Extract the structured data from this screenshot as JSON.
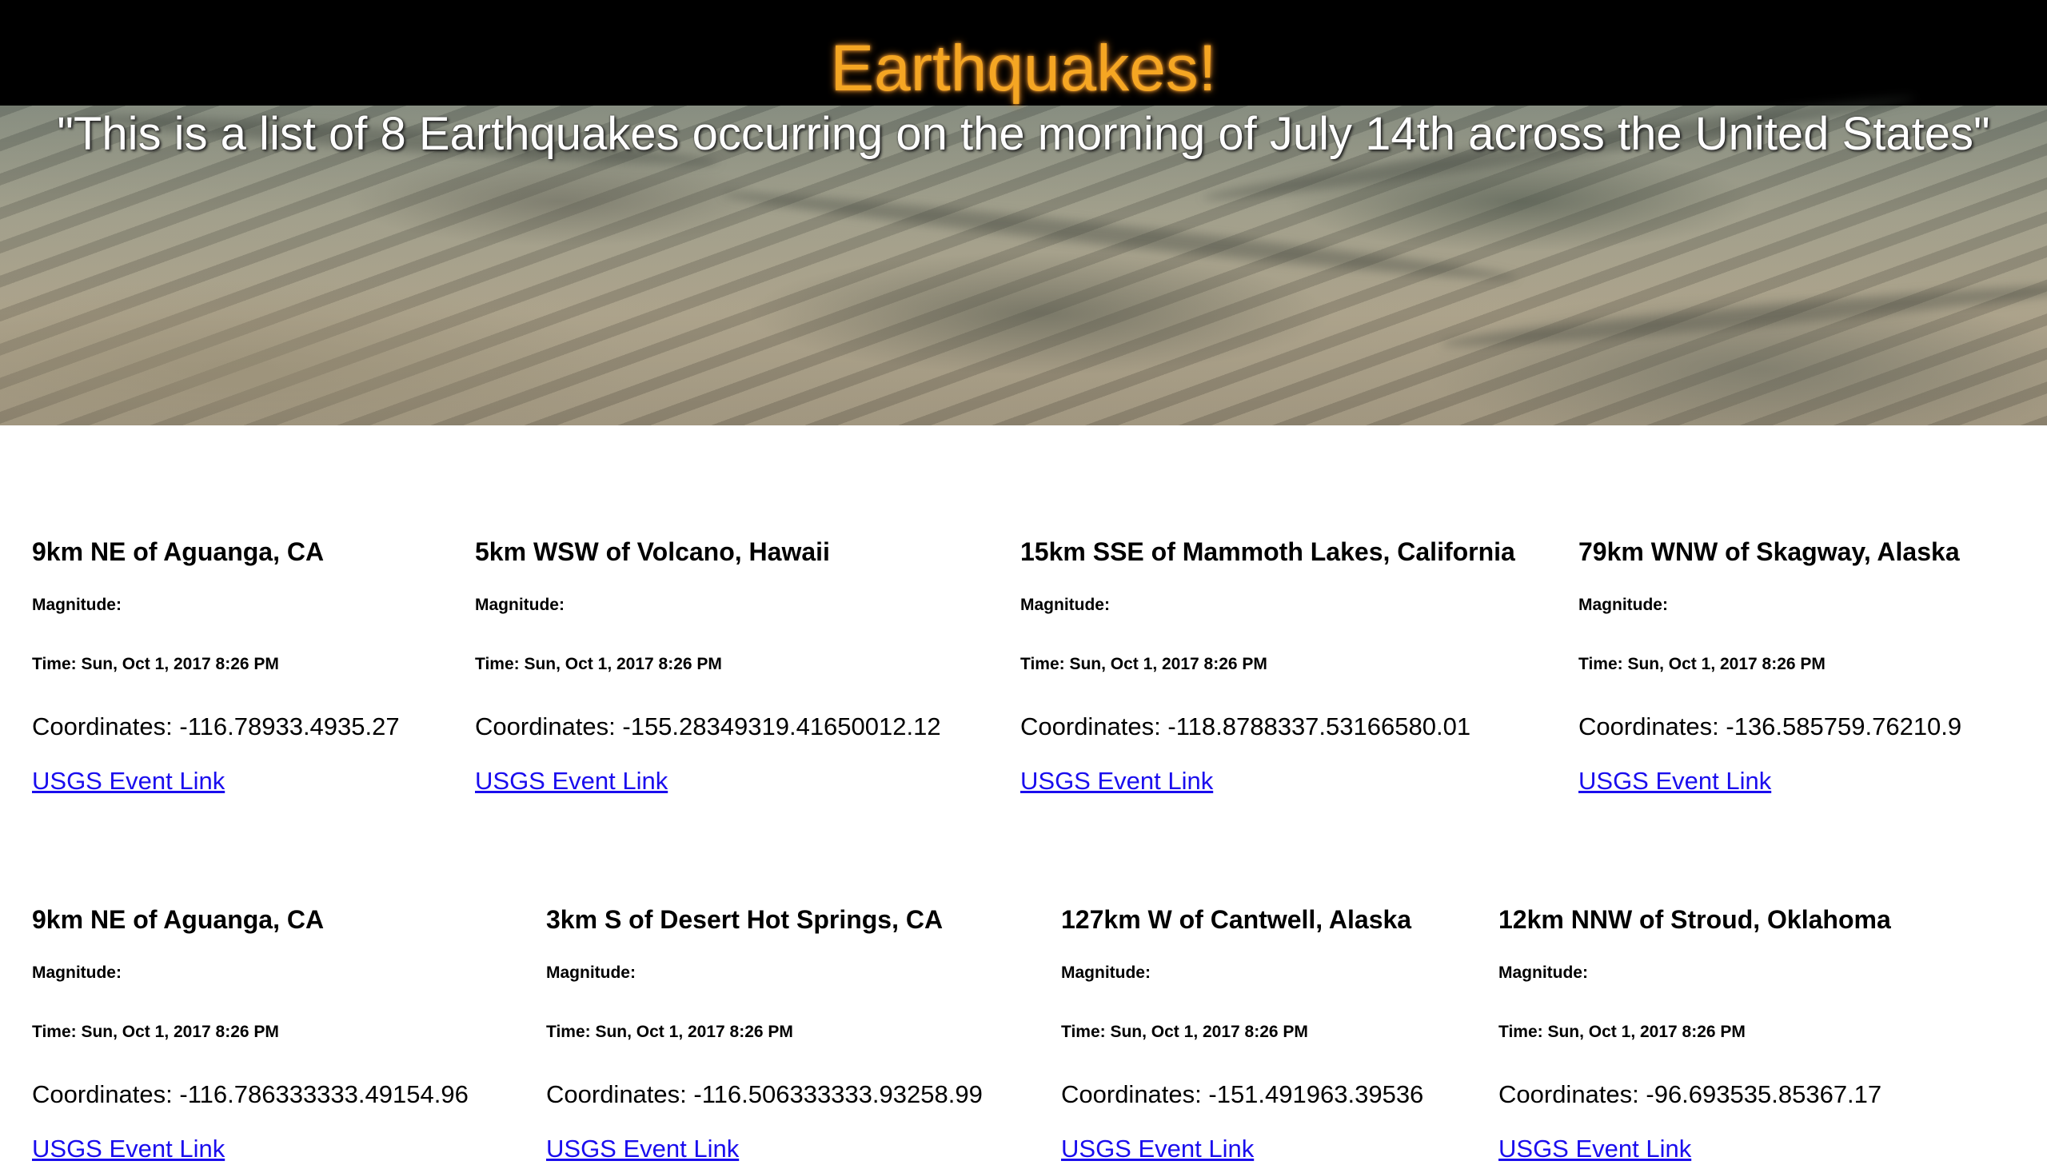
{
  "header": {
    "title": "Earthquakes!",
    "subtitle": "\"This is a list of 8 Earthquakes occurring on the morning of July 14th across the United States\""
  },
  "quakes": [
    {
      "place": "9km NE of Aguanga, CA",
      "magnitude_label": "Magnitude:",
      "time_label": "Time: Sun, Oct 1, 2017 8:26 PM",
      "coordinates_label": "Coordinates: -116.78933.4935.27",
      "link_label": "USGS Event Link"
    },
    {
      "place": "5km WSW of Volcano, Hawaii",
      "magnitude_label": "Magnitude:",
      "time_label": "Time: Sun, Oct 1, 2017 8:26 PM",
      "coordinates_label": "Coordinates: -155.28349319.41650012.12",
      "link_label": "USGS Event Link"
    },
    {
      "place": "15km SSE of Mammoth Lakes, California",
      "magnitude_label": "Magnitude:",
      "time_label": "Time: Sun, Oct 1, 2017 8:26 PM",
      "coordinates_label": "Coordinates: -118.8788337.53166580.01",
      "link_label": "USGS Event Link"
    },
    {
      "place": "79km WNW of Skagway, Alaska",
      "magnitude_label": "Magnitude:",
      "time_label": "Time: Sun, Oct 1, 2017 8:26 PM",
      "coordinates_label": "Coordinates: -136.585759.76210.9",
      "link_label": "USGS Event Link"
    },
    {
      "place": "9km NE of Aguanga, CA",
      "magnitude_label": "Magnitude:",
      "time_label": "Time: Sun, Oct 1, 2017 8:26 PM",
      "coordinates_label": "Coordinates: -116.786333333.49154.96",
      "link_label": "USGS Event Link"
    },
    {
      "place": "3km S of Desert Hot Springs, CA",
      "magnitude_label": "Magnitude:",
      "time_label": "Time: Sun, Oct 1, 2017 8:26 PM",
      "coordinates_label": "Coordinates: -116.506333333.93258.99",
      "link_label": "USGS Event Link"
    },
    {
      "place": "127km W of Cantwell, Alaska",
      "magnitude_label": "Magnitude:",
      "time_label": "Time: Sun, Oct 1, 2017 8:26 PM",
      "coordinates_label": "Coordinates: -151.491963.39536",
      "link_label": "USGS Event Link"
    },
    {
      "place": "12km NNW of Stroud, Oklahoma",
      "magnitude_label": "Magnitude:",
      "time_label": "Time: Sun, Oct 1, 2017 8:26 PM",
      "coordinates_label": "Coordinates: -96.693535.85367.17",
      "link_label": "USGS Event Link"
    }
  ]
}
